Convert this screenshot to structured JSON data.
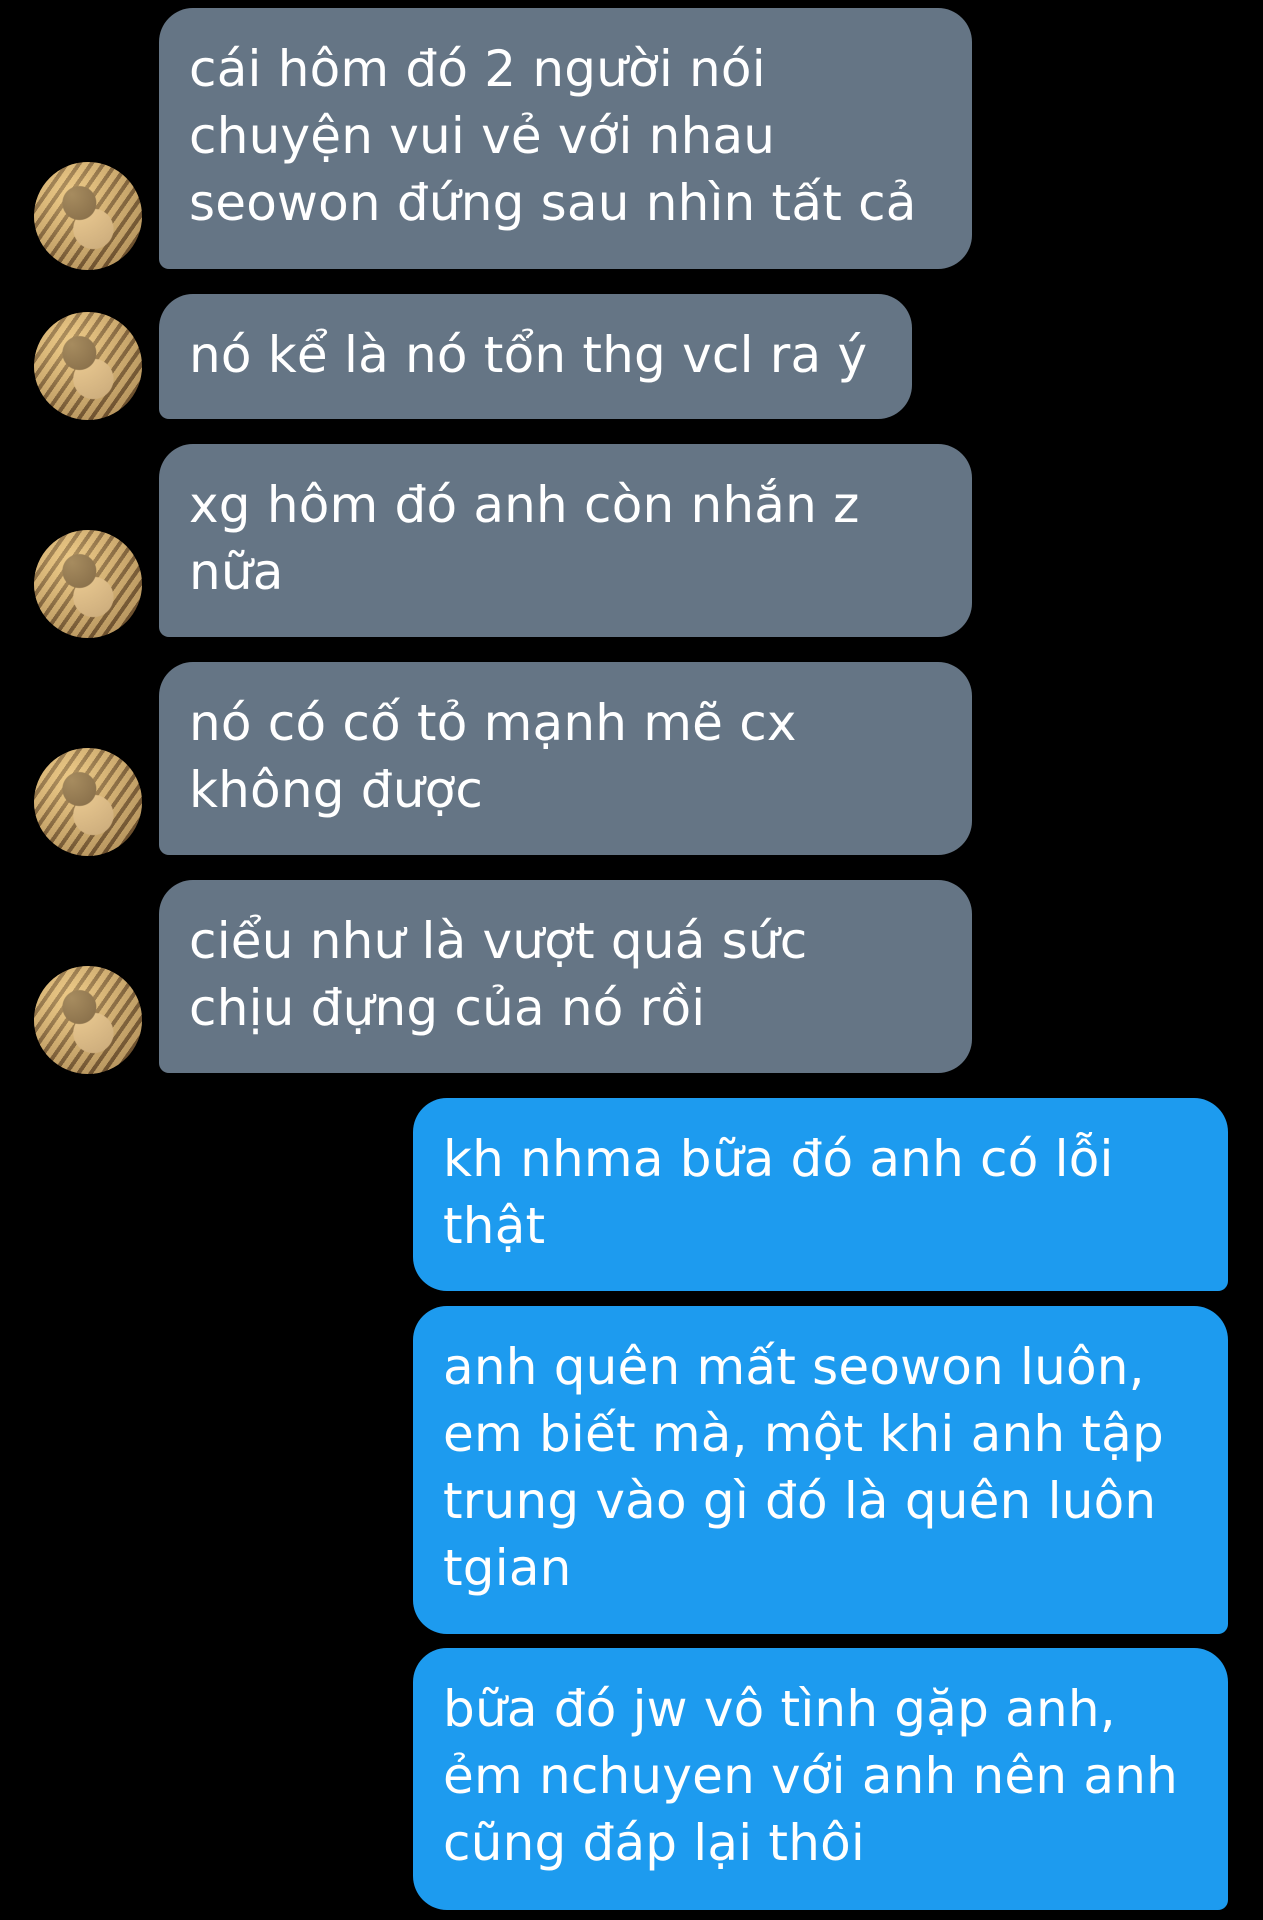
{
  "conversation": {
    "incoming": [
      {
        "text": "cái hôm đó 2 người nói\nchuyện vui vẻ với nhau\nseowon đứng sau nhìn tất cả"
      },
      {
        "text": "nó kể là nó tổn thg vcl ra ý"
      },
      {
        "text": "xg hôm đó anh còn nhắn z\nnữa"
      },
      {
        "text": "nó có cố tỏ mạnh mẽ cx\nkhông được"
      },
      {
        "text": "ciểu như là vượt quá sức\nchịu đựng của nó rồi"
      }
    ],
    "outgoing": [
      {
        "text": "kh nhma bữa đó anh có lỗi\nthật"
      },
      {
        "text": "anh quên mất seowon luôn,\nem biết mà, một khi anh tập\ntrung vào gì đó là quên luôn\ntgian"
      },
      {
        "text": "bữa đó jw vô tình gặp anh,\nẻm nchuyen với anh nên anh\ncũng đáp lại thôi"
      }
    ]
  },
  "avatar": {
    "icon": "contact-avatar-photo"
  },
  "colors": {
    "background": "#000000",
    "incoming_bubble": "#657585",
    "outgoing_bubble": "#1d9bef",
    "text": "#ffffff"
  }
}
